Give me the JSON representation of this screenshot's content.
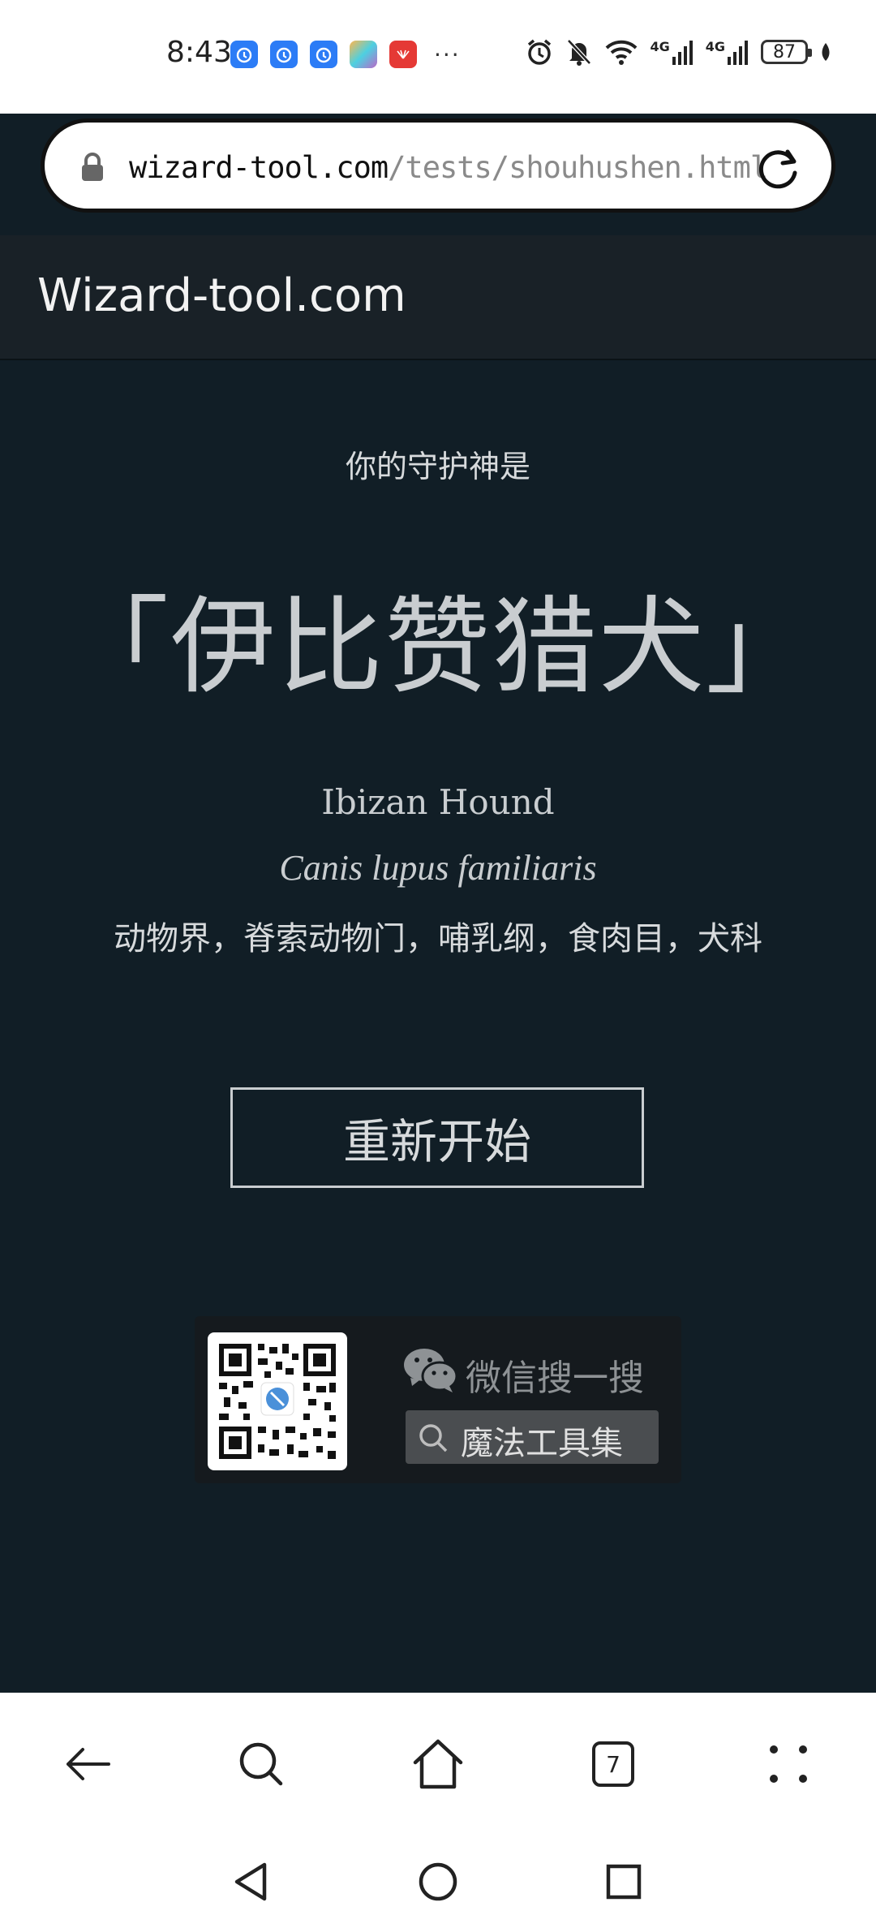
{
  "status_bar": {
    "time": "8:43",
    "network_1": "4G",
    "network_2": "4G",
    "battery": "87",
    "notification_overflow": "···"
  },
  "browser": {
    "url_host": "wizard-tool.com",
    "url_path": "/tests/shouhushen.html",
    "tab_count": "7"
  },
  "site": {
    "title": "Wizard-tool.com"
  },
  "result": {
    "intro": "你的守护神是",
    "name": "「伊比赞猎犬」",
    "english_name": "Ibizan Hound",
    "scientific_name": "Canis lupus familiaris",
    "taxonomy": "动物界，脊索动物门，哺乳纲，食肉目，犬科",
    "restart_label": "重新开始"
  },
  "wechat": {
    "label": "微信搜一搜",
    "search_text": "魔法工具集"
  },
  "colors": {
    "page_background": "#111e26",
    "header_background": "#192127",
    "text_light": "#c9cdd0"
  }
}
